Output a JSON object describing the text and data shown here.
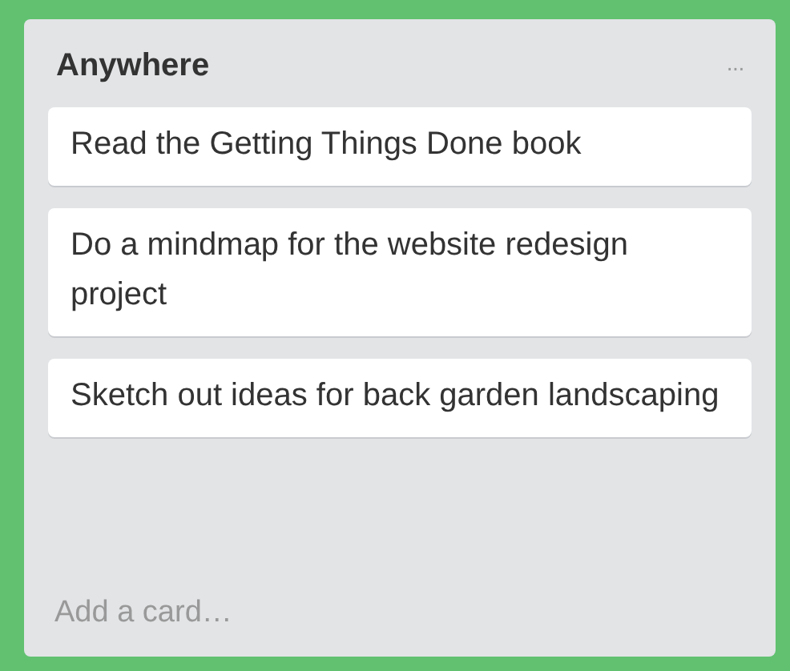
{
  "list": {
    "title": "Anywhere",
    "menu": "···",
    "cards": [
      {
        "text": "Read the Getting Things Done book"
      },
      {
        "text": "Do a mindmap for the website redesign project"
      },
      {
        "text": "Sketch out ideas for back garden landscaping"
      }
    ],
    "add_card": "Add a card…"
  }
}
